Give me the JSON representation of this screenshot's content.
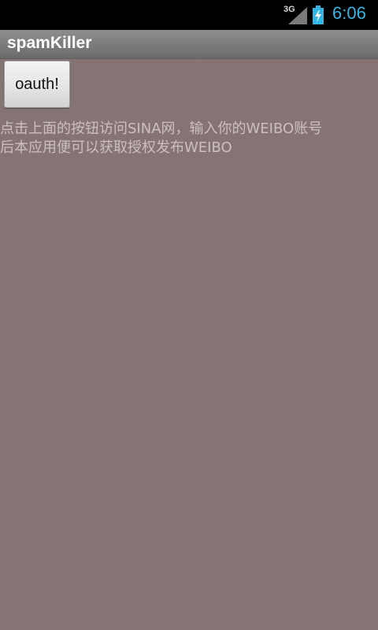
{
  "status_bar": {
    "network_type": "3G",
    "time": "6:06",
    "icons": [
      "signal-icon",
      "battery-charging-icon"
    ],
    "clock_color": "#33b5e5"
  },
  "title_bar": {
    "title": "spamKiller"
  },
  "main": {
    "oauth_button_label": "oauth!",
    "instruction_line1": "点击上面的按钮访问SINA网，输入你的WEIBO账号",
    "instruction_line2": "后本应用便可以获取授权发布WEIBO"
  },
  "colors": {
    "background": "#857473",
    "text": "#cbc0bf"
  }
}
